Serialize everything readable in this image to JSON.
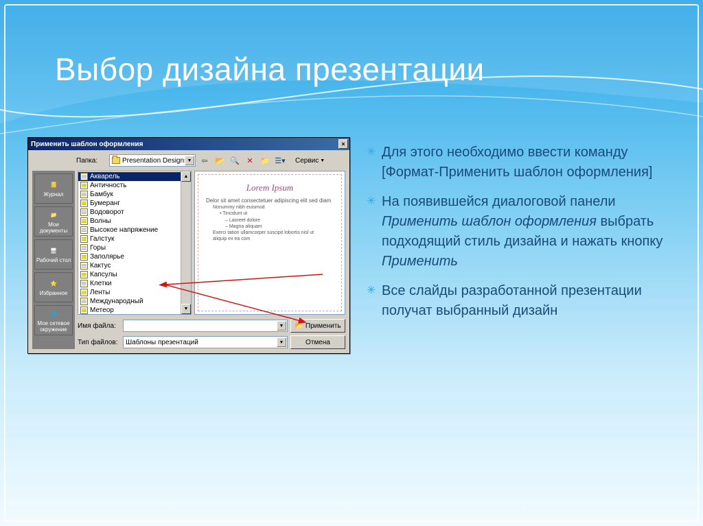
{
  "slide": {
    "title": "Выбор дизайна презентации",
    "bullets": [
      "Для этого необходимо ввести команду [Формат-Применить шаблон оформления]",
      "На появившейся диалоговой панели <em>Применить шаблон оформления</em> выбрать подходящий стиль дизайна и нажать кнопку <em>Применить</em>",
      "Все слайды разработанной презентации получат выбранный дизайн"
    ]
  },
  "dialog": {
    "title": "Применить шаблон оформления",
    "folder_label": "Папка:",
    "folder_value": "Presentation Designs",
    "service_label": "Сервис",
    "places": [
      {
        "name": "journal",
        "label": "Журнал"
      },
      {
        "name": "mydocs",
        "label": "Мои документы"
      },
      {
        "name": "desktop",
        "label": "Рабочий стол"
      },
      {
        "name": "favorites",
        "label": "Избранное"
      },
      {
        "name": "network",
        "label": "Мое сетевое окружение"
      }
    ],
    "files": [
      "Акварель",
      "Античность",
      "Бамбук",
      "Бумеранг",
      "Водоворот",
      "Волны",
      "Высокое напряжение",
      "Галстук",
      "Горы",
      "Заполярье",
      "Кактус",
      "Капсулы",
      "Клетки",
      "Ленты",
      "Международный",
      "Метеор"
    ],
    "selected_index": 0,
    "preview": {
      "heading": "Lorem Ipsum",
      "line1": "Delor sit amet consectetuer adipiscing elit sed diam",
      "line2": "Nonummy nibh euismod",
      "sub1": "Tincidunt ut",
      "sub2a": "Laoreet dolore",
      "sub2b": "Magna aliquam",
      "line3": "Exerci tation ullamcorper suscipit lobortis nisl ut",
      "line4": "aliquip ex ea com"
    },
    "filename_label": "Имя файла:",
    "filename_value": "",
    "filetype_label": "Тип файлов:",
    "filetype_value": "Шаблоны презентаций",
    "apply_btn": "Применить",
    "cancel_btn": "Отмена"
  }
}
